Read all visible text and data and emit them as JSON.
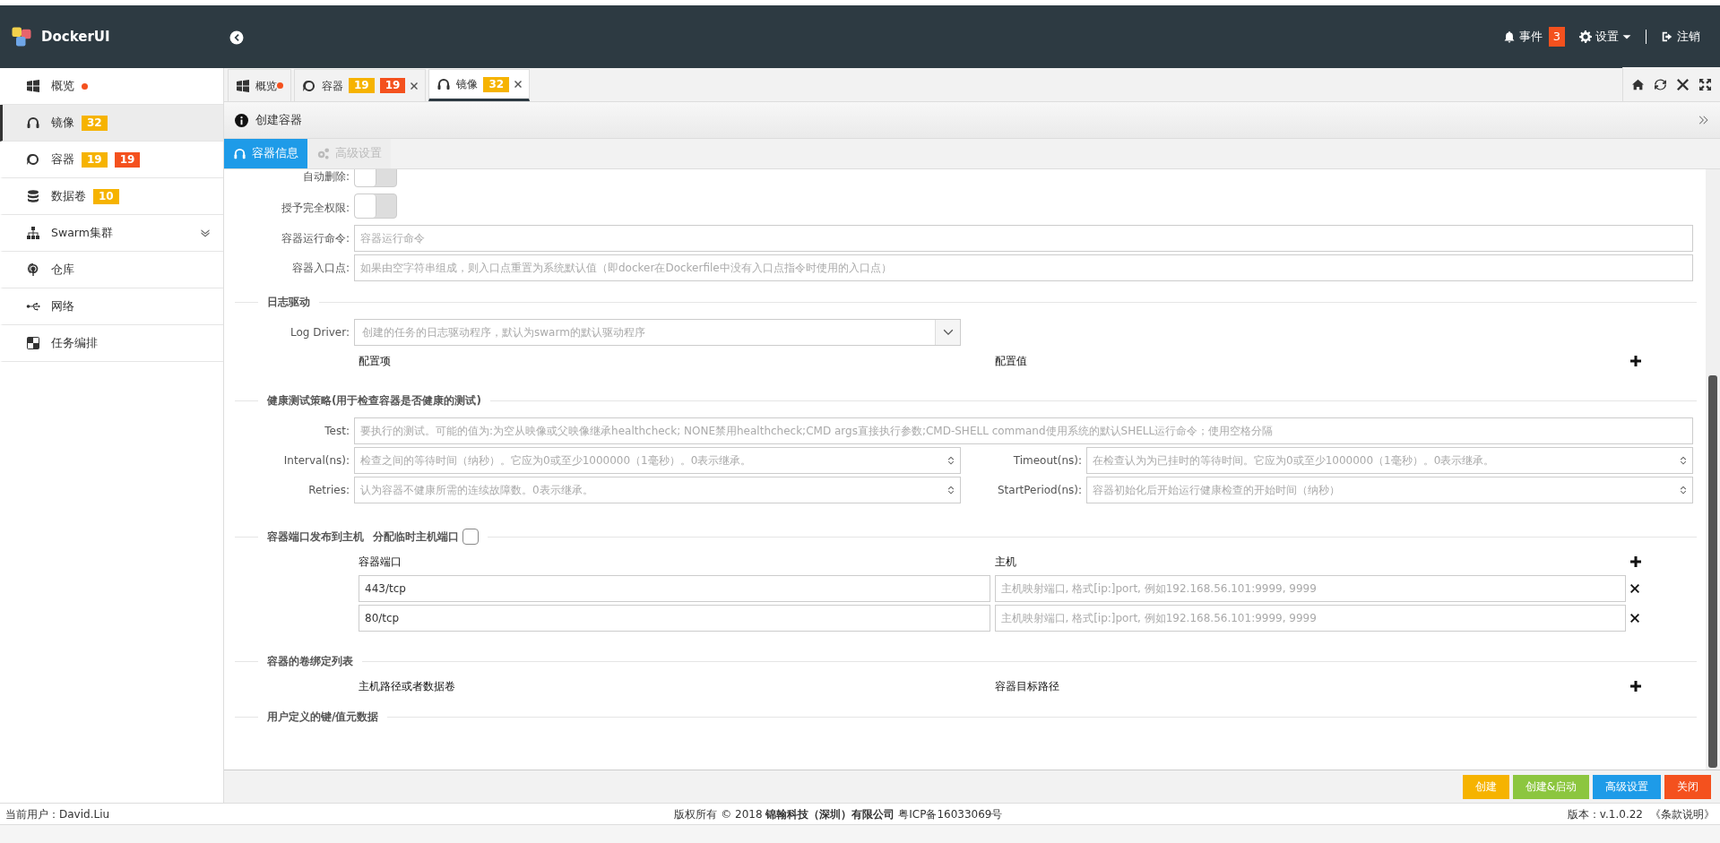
{
  "header": {
    "logo": "DockerUI",
    "events": {
      "label": "事件",
      "count": "3"
    },
    "settings": "设置",
    "logout": "注销"
  },
  "sidebar": {
    "items": [
      {
        "label": "概览",
        "dot": true,
        "selected": false,
        "expandable": false
      },
      {
        "label": "镜像",
        "dot": false,
        "badges": [
          {
            "text": "32",
            "color": "#f6b300"
          }
        ],
        "selected": true,
        "expandable": false
      },
      {
        "label": "容器",
        "dot": false,
        "badges": [
          {
            "text": "19",
            "color": "#f6b300"
          },
          {
            "text": "19",
            "color": "#f4511e"
          }
        ],
        "selected": false,
        "expandable": false
      },
      {
        "label": "数据卷",
        "dot": false,
        "badges": [
          {
            "text": "10",
            "color": "#f6b300"
          }
        ],
        "selected": false,
        "expandable": false
      },
      {
        "label": "Swarm集群",
        "dot": false,
        "selected": false,
        "expandable": true
      },
      {
        "label": "仓库",
        "dot": false,
        "selected": false,
        "expandable": false
      },
      {
        "label": "网络",
        "dot": false,
        "selected": false,
        "expandable": false
      },
      {
        "label": "任务编排",
        "dot": false,
        "selected": false,
        "expandable": false
      }
    ]
  },
  "tabs": [
    {
      "kind": "overview",
      "label": "概览",
      "dot": true,
      "closable": false,
      "selected": false
    },
    {
      "kind": "containers",
      "label": "容器",
      "dot": false,
      "badges": [
        {
          "text": "19",
          "color": "#f6b300"
        },
        {
          "text": "19",
          "color": "#f4511e"
        }
      ],
      "closable": true,
      "selected": false
    },
    {
      "kind": "images",
      "label": "镜像",
      "dot": false,
      "badges": [
        {
          "text": "32",
          "color": "#f6b300"
        }
      ],
      "closable": true,
      "selected": true
    }
  ],
  "page_title": "创建容器",
  "subtabs": [
    {
      "label": "容器信息",
      "selected": true,
      "disabled": false
    },
    {
      "label": "高级设置",
      "selected": false,
      "disabled": true
    }
  ],
  "form": {
    "top_fields": [
      {
        "kind": "toggle",
        "label": "自动删除:",
        "on": false
      },
      {
        "kind": "toggle",
        "label": "授予完全权限:",
        "on": false
      },
      {
        "kind": "text",
        "label": "容器运行命令:",
        "placeholder": "容器运行命令"
      },
      {
        "kind": "text",
        "label": "容器入口点:",
        "placeholder": "如果由空字符串组成，则入口点重置为系统默认值（即docker在Dockerfile中没有入口点指令时使用的入口点）"
      }
    ],
    "log_section": {
      "title": "日志驱动",
      "driver": {
        "label": "Log Driver:",
        "placeholder": "创建的任务的日志驱动程序，默认为swarm的默认驱动程序"
      },
      "columns": [
        "配置项",
        "配置值"
      ]
    },
    "health_section": {
      "title": "健康测试策略(用于检查容器是否健康的测试)",
      "test": {
        "label": "Test:",
        "placeholder": "要执行的测试。可能的值为:为空从映像或父映像继承healthcheck; NONE禁用healthcheck;CMD args直接执行参数;CMD-SHELL command使用系统的默认SHELL运行命令；使用空格分隔"
      },
      "number_fields": [
        {
          "label": "Interval(ns):",
          "placeholder": "检查之间的等待时间（纳秒）。它应为0或至少1000000（1毫秒）。0表示继承。"
        },
        {
          "label": "Timeout(ns):",
          "placeholder": "在检查认为为已挂时的等待时间。它应为0或至少1000000（1毫秒）。0表示继承。"
        },
        {
          "label": "Retries:",
          "placeholder": "认为容器不健康所需的连续故障数。0表示继承。"
        },
        {
          "label": "StartPeriod(ns):",
          "placeholder": "容器初始化后开始运行健康检查的开始时间（纳秒）"
        }
      ]
    },
    "ports_section": {
      "title": "容器端口发布到主机",
      "ephemeral": {
        "label": "分配临时主机端口",
        "checked": false
      },
      "columns": [
        "容器端口",
        "主机"
      ],
      "rows": [
        {
          "port": "443/tcp",
          "host_placeholder": "主机映射端口, 格式[ip:]port, 例如192.168.56.101:9999, 9999"
        },
        {
          "port": "80/tcp",
          "host_placeholder": "主机映射端口, 格式[ip:]port, 例如192.168.56.101:9999, 9999"
        }
      ]
    },
    "volumes_section": {
      "title": "容器的卷绑定列表",
      "columns": [
        "主机路径或者数据卷",
        "容器目标路径"
      ]
    },
    "metadata_section": {
      "title": "用户定义的键/值元数据"
    }
  },
  "action_buttons": [
    {
      "label": "创建",
      "color": "#f6b300"
    },
    {
      "label": "创建&启动",
      "color": "#8cc63f"
    },
    {
      "label": "高级设置",
      "color": "#1e9be8"
    },
    {
      "label": "关闭",
      "color": "#f4511e"
    }
  ],
  "footer": {
    "user": "当前用户：David.Liu",
    "copyright": "版权所有 © 2018 **锦翰科技（深圳）有限公司** 粤ICP备16033069号",
    "version": "版本：v.1.0.22",
    "terms": "《条款说明》"
  }
}
